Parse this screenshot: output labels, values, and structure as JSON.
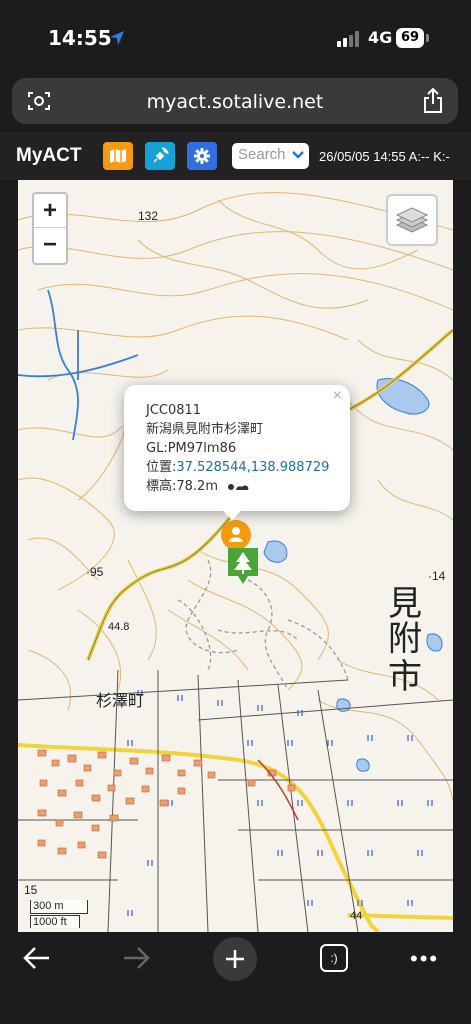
{
  "status_bar": {
    "time": "14:55",
    "network": "4G",
    "battery": "69"
  },
  "browser": {
    "url": "myact.sotalive.net"
  },
  "app": {
    "title": "MyACT",
    "search_placeholder": "Search",
    "status_text": "26/05/05 14:55 A:-- K:-",
    "accent_colors": {
      "orange": "#f39c12",
      "cyan": "#17a2d6",
      "blue": "#2f6fe0"
    }
  },
  "map": {
    "zoom_in_label": "+",
    "zoom_out_label": "−",
    "zoom_level": "15",
    "scale_metric": "300 m",
    "scale_imperial": "1000 ft",
    "place_labels": {
      "city_kanji_1": "見",
      "city_kanji_2": "附",
      "city_kanji_3": "市",
      "town": "杉澤町",
      "elev_132": "132",
      "elev_95": "·95",
      "elev_44_8": "44.8",
      "elev_14": "·14",
      "elev_44": "44"
    },
    "popup": {
      "ref": "JCC0811",
      "address": "新潟県見附市杉澤町",
      "grid": "GL:PM97lm86",
      "position_label": "位置:",
      "position_value": "37.528544,138.988729",
      "elevation": "標高:78.2m",
      "close_label": "×"
    }
  }
}
